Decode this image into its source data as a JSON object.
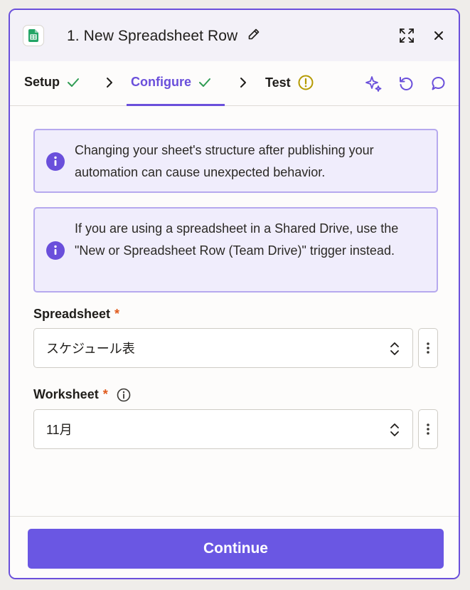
{
  "header": {
    "title": "1. New Spreadsheet Row",
    "app_icon": "google-sheets-icon",
    "actions": [
      "expand-icon",
      "close-icon"
    ]
  },
  "steps": [
    {
      "label": "Setup",
      "status": "complete"
    },
    {
      "label": "Configure",
      "status": "complete",
      "active": true
    },
    {
      "label": "Test",
      "status": "warning"
    }
  ],
  "toolbar": [
    "sparkle-icon",
    "undo-icon",
    "comment-icon"
  ],
  "alerts": [
    {
      "text": "Changing your sheet's structure after publishing your automation can cause unexpected behavior."
    },
    {
      "text": "If you are using a spreadsheet in a Shared Drive, use the \"New or Spreadsheet Row (Team Drive)\" trigger instead."
    }
  ],
  "fields": {
    "spreadsheet": {
      "label": "Spreadsheet",
      "required": "*",
      "value": "スケジュール表"
    },
    "worksheet": {
      "label": "Worksheet",
      "required": "*",
      "value": "11月"
    }
  },
  "footer": {
    "continue_label": "Continue"
  },
  "colors": {
    "accent": "#6a4fdb",
    "button": "#6a57e3",
    "success": "#2f9c53",
    "warning": "#b59a00",
    "required": "#e05a1c"
  }
}
